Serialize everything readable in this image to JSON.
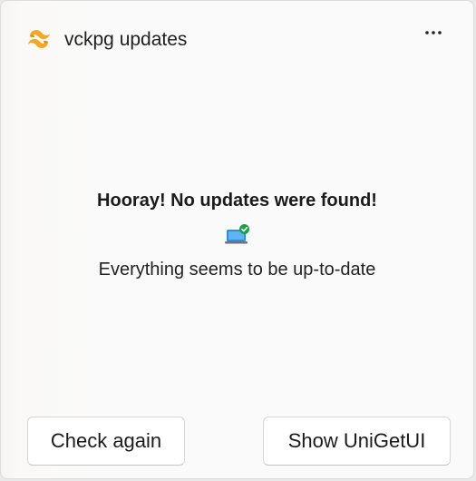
{
  "header": {
    "title": "vckpg updates",
    "app_icon": "unigetui-logo-icon",
    "more_icon": "more-dots-icon"
  },
  "main": {
    "headline": "Hooray! No updates were found!",
    "status_icon": "laptop-check-icon",
    "subtext": "Everything seems to be up-to-date"
  },
  "actions": {
    "check_again_label": "Check again",
    "show_app_label": "Show UniGetUI"
  },
  "colors": {
    "brand_orange": "#f5a623",
    "success_green": "#16a34a",
    "laptop_blue": "#2f8ee0"
  }
}
